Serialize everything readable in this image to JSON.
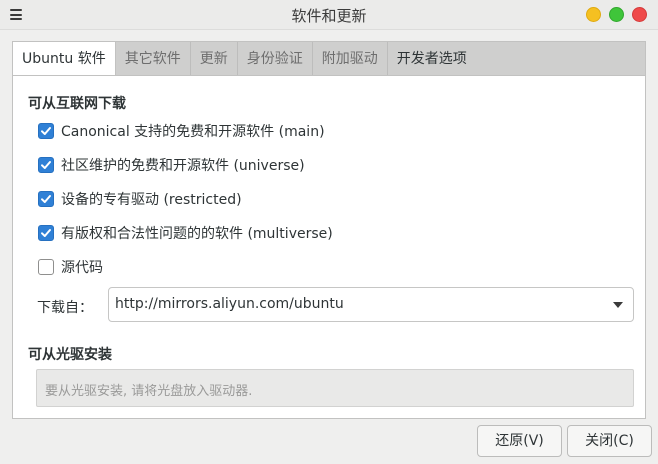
{
  "window": {
    "title": "软件和更新"
  },
  "tabs": [
    {
      "label": "Ubuntu 软件",
      "active": true
    },
    {
      "label": "其它软件",
      "active": false
    },
    {
      "label": "更新",
      "active": false
    },
    {
      "label": "身份验证",
      "active": false
    },
    {
      "label": "附加驱动",
      "active": false
    },
    {
      "label": "开发者选项",
      "active": false
    }
  ],
  "internet": {
    "heading": "可从互联网下载",
    "options": [
      {
        "label": "Canonical 支持的免费和开源软件 (main)",
        "checked": true
      },
      {
        "label": "社区维护的免费和开源软件 (universe)",
        "checked": true
      },
      {
        "label": "设备的专有驱动 (restricted)",
        "checked": true
      },
      {
        "label": "有版权和合法性问题的的软件 (multiverse)",
        "checked": true
      },
      {
        "label": "源代码",
        "checked": false
      }
    ],
    "download_from_label": "下载自：",
    "download_from_value": "http://mirrors.aliyun.com/ubuntu"
  },
  "cdrom": {
    "heading": "可从光驱安装",
    "placeholder": "要从光驱安装, 请将光盘放入驱动器."
  },
  "buttons": {
    "revert": "还原(V)",
    "close": "关闭(C)"
  },
  "colors": {
    "checkbox_accent": "#2f80d6",
    "close_button": "#ef4a4a",
    "minimize_button": "#f5c021",
    "maximize_button": "#3fc53a"
  }
}
